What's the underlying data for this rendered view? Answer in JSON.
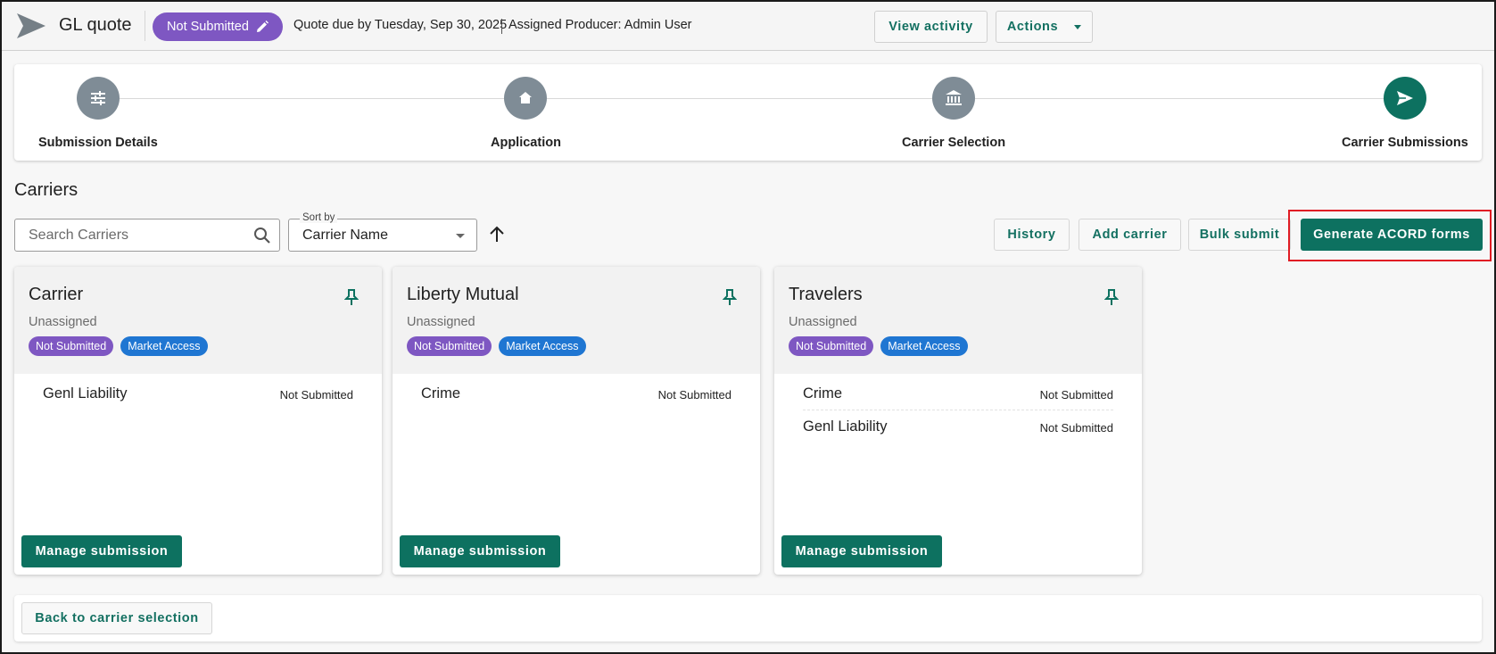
{
  "header": {
    "title": "GL quote",
    "status": "Not Submitted",
    "due": "Quote due by Tuesday, Sep 30, 2025",
    "producer": "Assigned Producer: Admin User",
    "view_activity": "View activity",
    "actions": "Actions"
  },
  "steps": [
    {
      "label": "Submission Details",
      "icon": "sliders-icon"
    },
    {
      "label": "Application",
      "icon": "home-icon"
    },
    {
      "label": "Carrier Selection",
      "icon": "bank-icon"
    },
    {
      "label": "Carrier Submissions",
      "icon": "send-icon"
    }
  ],
  "carriers_section": {
    "title": "Carriers",
    "search_placeholder": "Search Carriers",
    "sort_label": "Sort by",
    "sort_value": "Carrier Name",
    "history": "History",
    "add_carrier": "Add carrier",
    "bulk_submit": "Bulk submit",
    "generate_acord": "Generate ACORD forms"
  },
  "cards": [
    {
      "name": "Carrier",
      "assignment": "Unassigned",
      "badges": [
        "Not Submitted",
        "Market Access"
      ],
      "lines": [
        {
          "name": "Genl Liability",
          "status": "Not Submitted"
        }
      ],
      "manage": "Manage submission"
    },
    {
      "name": "Liberty Mutual",
      "assignment": "Unassigned",
      "badges": [
        "Not Submitted",
        "Market Access"
      ],
      "lines": [
        {
          "name": "Crime",
          "status": "Not Submitted"
        }
      ],
      "manage": "Manage submission"
    },
    {
      "name": "Travelers",
      "assignment": "Unassigned",
      "badges": [
        "Not Submitted",
        "Market Access"
      ],
      "lines": [
        {
          "name": "Crime",
          "status": "Not Submitted"
        },
        {
          "name": "Genl Liability",
          "status": "Not Submitted"
        }
      ],
      "manage": "Manage submission"
    }
  ],
  "footer": {
    "back": "Back to carrier selection"
  },
  "colors": {
    "primary": "#0d7160",
    "purple": "#7e57c2",
    "blue": "#1f76d2",
    "step_inactive": "#7f8c96"
  }
}
